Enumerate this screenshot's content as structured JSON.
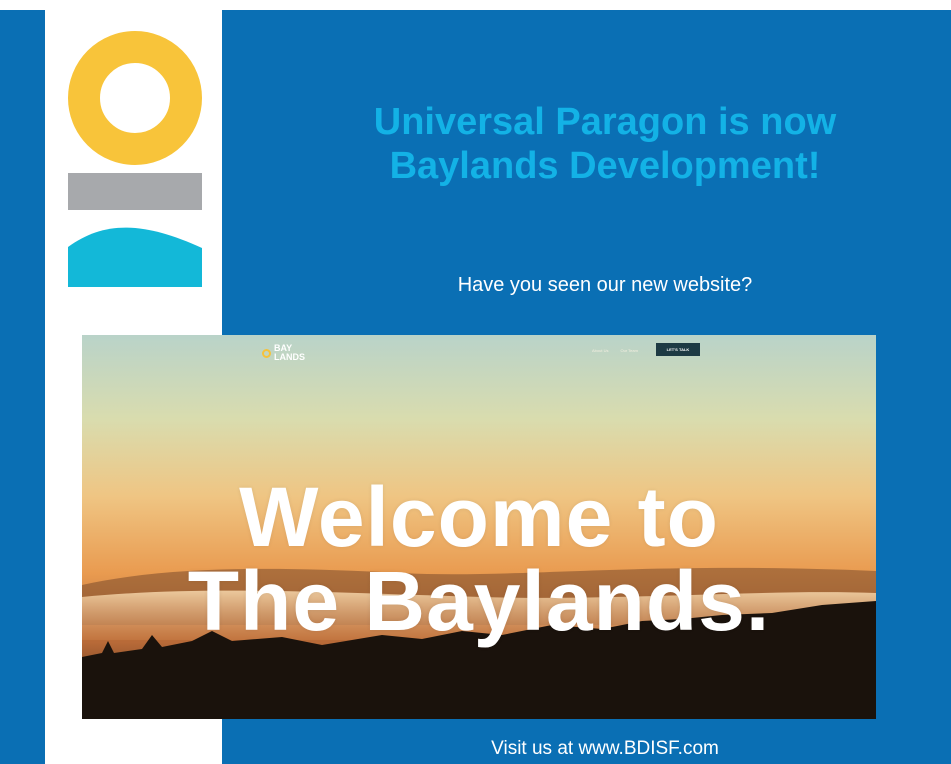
{
  "headline": {
    "line1": "Universal Paragon is now",
    "line2": "Baylands Development!"
  },
  "subheadline": "Have you seen our new website?",
  "footer": "Visit us at www.BDISF.com",
  "website_screenshot": {
    "logo_line1": "BAY",
    "logo_line2": "LANDS",
    "nav_items": [
      "About Us",
      "Our Team"
    ],
    "cta_label": "LET'S TALK",
    "hero_line1": "Welcome to",
    "hero_line2": "The Baylands."
  },
  "colors": {
    "blue": "#0a6fb4",
    "headline_cyan": "#13b2e6",
    "logo_yellow": "#f8c43a",
    "logo_gray": "#a7a9ac",
    "logo_teal": "#13b8d8",
    "sunset_orange": "#e89a4c"
  },
  "icons": [
    "yellow-ring-icon",
    "gray-bar-icon",
    "teal-wave-icon"
  ]
}
